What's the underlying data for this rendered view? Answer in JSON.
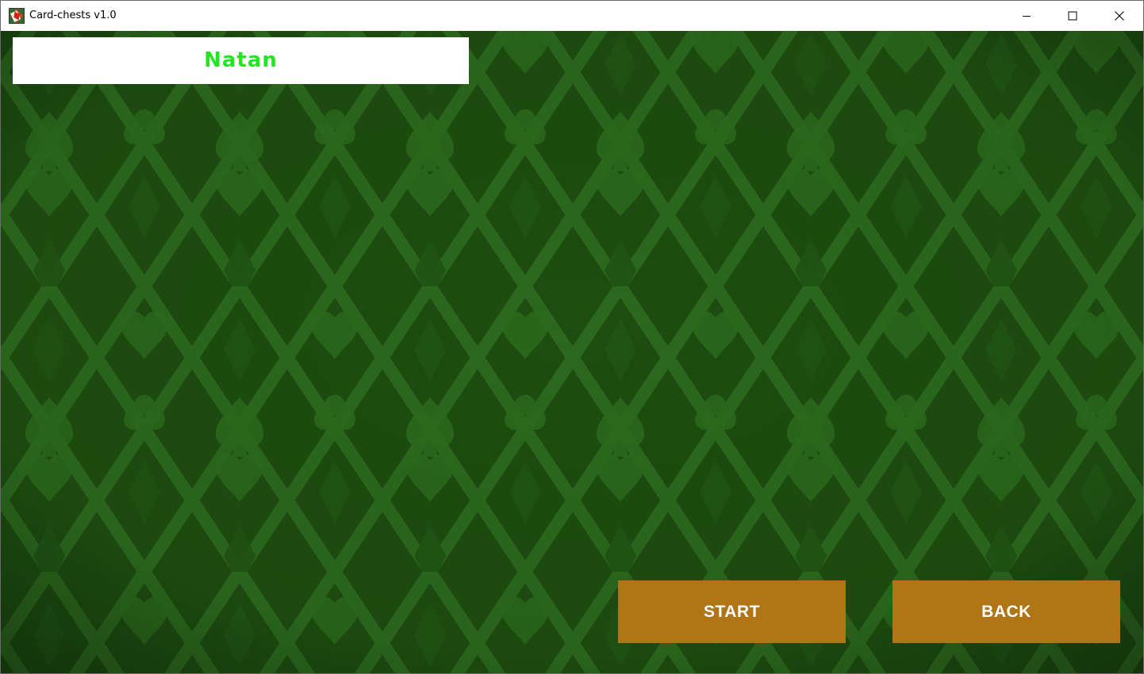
{
  "window": {
    "title": "Card-chests v1.0",
    "icon": "card-app-icon",
    "controls": {
      "minimize_icon": "minimize-icon",
      "maximize_icon": "maximize-icon",
      "close_icon": "close-icon"
    }
  },
  "game": {
    "background": {
      "pattern": "card-suits",
      "base_color": "#1d4d10",
      "pattern_color": "#2a6a1a"
    },
    "player": {
      "name": "Natan",
      "name_color": "#21e621"
    },
    "buttons": {
      "start_label": "START",
      "back_label": "BACK",
      "color": "#b07515"
    }
  }
}
